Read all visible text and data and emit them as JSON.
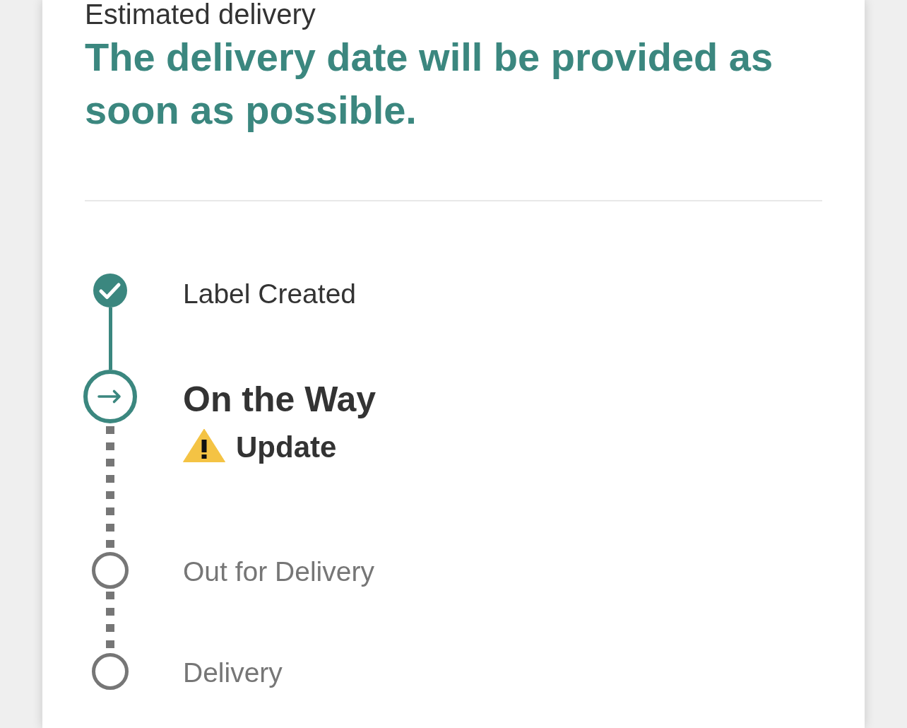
{
  "estimated_delivery": {
    "label": "Estimated delivery",
    "message": "The delivery date will be provided as soon as possible."
  },
  "timeline": {
    "steps": [
      {
        "label": "Label Created",
        "kind": "completed"
      },
      {
        "label": "On the Way",
        "kind": "current",
        "alert": "Update"
      },
      {
        "label": "Out for Delivery",
        "kind": "pending"
      },
      {
        "label": "Delivery",
        "kind": "pending"
      }
    ]
  }
}
